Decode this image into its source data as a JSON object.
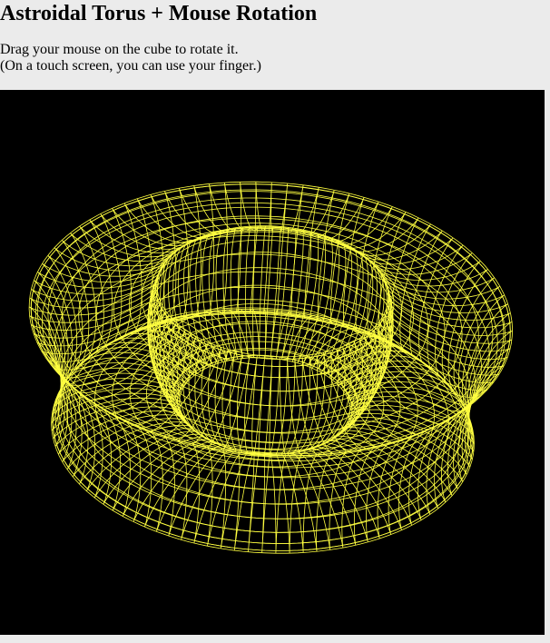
{
  "page": {
    "title": "Astroidal Torus + Mouse Rotation",
    "instructions": [
      "Drag your mouse on the cube to rotate it.",
      "(On a touch screen, you can use your finger.)"
    ]
  },
  "canvas": {
    "background": "#000000",
    "stroke_color": "#ffff40",
    "shape": "astroidal torus wireframe"
  }
}
